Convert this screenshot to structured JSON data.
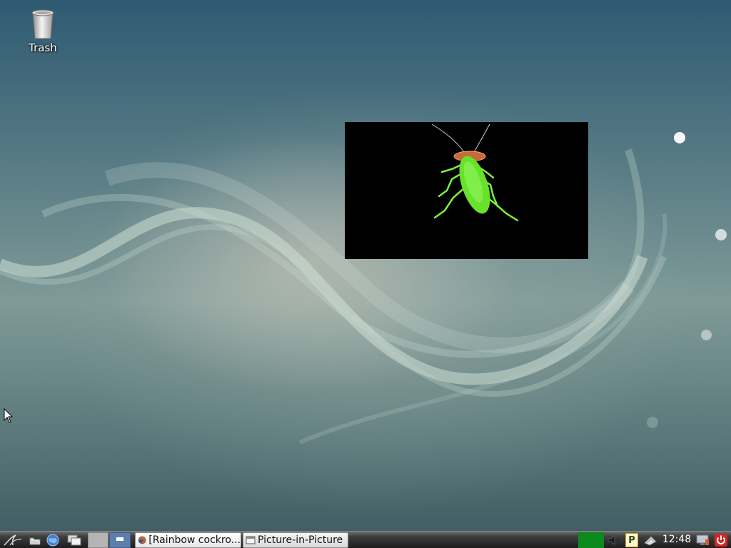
{
  "desktop": {
    "icons": [
      {
        "label": "Trash",
        "icon": "trash-icon"
      }
    ],
    "pip_window": {
      "content": "video-frame-green-cockroach",
      "background": "#000000"
    }
  },
  "taskbar": {
    "launchers": [
      {
        "icon": "menu-logo-icon"
      },
      {
        "icon": "file-manager-icon"
      },
      {
        "icon": "web-browser-icon"
      },
      {
        "icon": "show-desktop-icon"
      }
    ],
    "workspaces": [
      {
        "icon": "workspace-1-icon",
        "active": false
      },
      {
        "icon": "workspace-2-icon",
        "active": true
      }
    ],
    "tasks": [
      {
        "label": "[Rainbow cockro...",
        "icon": "firefox-icon",
        "active": true
      },
      {
        "label": "Picture-in-Picture",
        "icon": "window-icon",
        "active": false
      }
    ],
    "tray": {
      "cpu_monitor_color": "#0b8a1e",
      "icons": [
        "volume-icon",
        "p-indicator-icon",
        "network-icon"
      ],
      "clock": "12:48",
      "extra_icons": [
        "screen-icon",
        "power-icon"
      ]
    }
  }
}
